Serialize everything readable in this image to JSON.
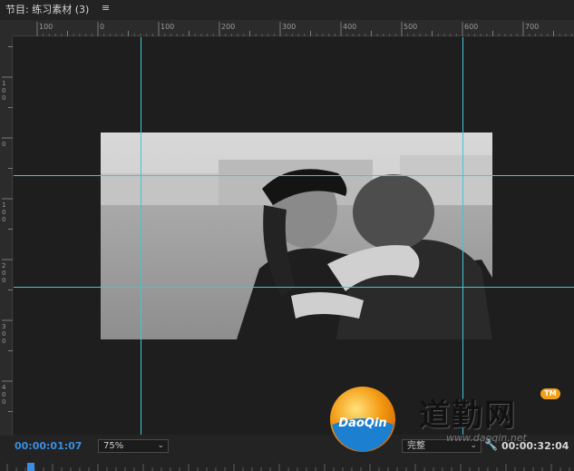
{
  "panel": {
    "title": "节目: 练习素材 (3)",
    "menu_icon": "≡"
  },
  "ruler": {
    "top_labels": [
      "100",
      "0",
      "100",
      "200",
      "300",
      "400",
      "500",
      "600",
      "700"
    ],
    "left_labels": [
      "100",
      "0",
      "100",
      "200",
      "300",
      "400"
    ]
  },
  "controls": {
    "current_timecode": "00:00:01:07",
    "zoom": "75%",
    "quality": "完整",
    "duration_timecode": "00:00:32:04"
  },
  "watermark": {
    "logo_text": "DaoQin",
    "site_name": "道勤网",
    "tm": "TM",
    "url": "www.daoqin.net"
  },
  "colors": {
    "guide": "#3fc7d8",
    "timecode_accent": "#3a8de0",
    "background": "#232323"
  }
}
